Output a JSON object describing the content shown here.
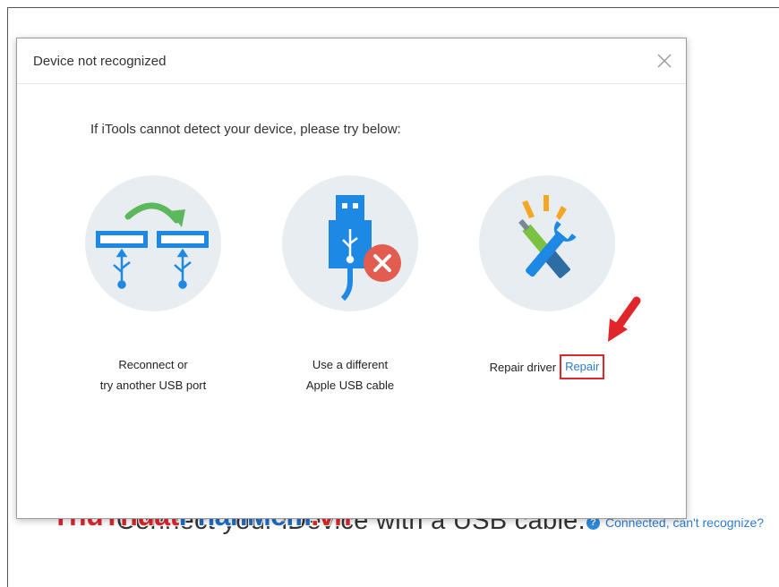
{
  "background": {
    "message": "Connect your iDevice with a USB cable.",
    "help_icon_glyph": "?",
    "help_link": "Connected, can't recognize?"
  },
  "watermark": {
    "part1": "ThuThuat",
    "part2": "PhanMem",
    "part3": ".vn"
  },
  "dialog": {
    "title": "Device not recognized",
    "instruction": "If iTools cannot detect your device, please try  below:",
    "options": [
      {
        "icon": "usb-ports-icon",
        "line1": "Reconnect or",
        "line2": "try another USB port"
      },
      {
        "icon": "usb-cable-error-icon",
        "line1": "Use a different",
        "line2": "Apple USB cable"
      },
      {
        "icon": "repair-tools-icon",
        "line1": "Repair driver",
        "link": "Repair"
      }
    ]
  },
  "colors": {
    "accent_blue": "#2b7cd3",
    "icon_blue": "#1e88e5",
    "circle_bg": "#e8edf1",
    "highlight_red": "#e0262a",
    "arrow_green": "#5cb85c",
    "error_red": "#e25c4f",
    "tool_green": "#7cc242",
    "spark_orange": "#f5a623"
  }
}
